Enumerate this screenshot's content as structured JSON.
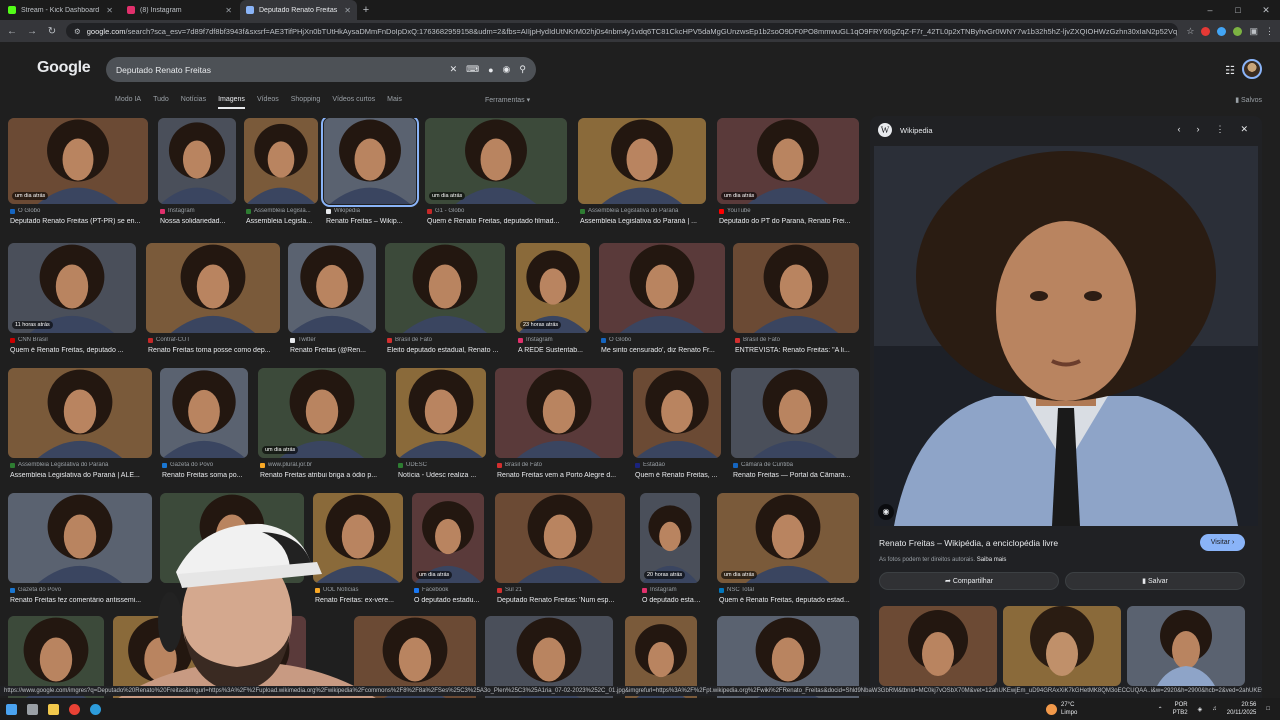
{
  "browser": {
    "tabs": [
      {
        "title": "Stream - Kick Dashboard",
        "color": "#53fc18"
      },
      {
        "title": "(8) Instagram",
        "color": "#e1306c"
      },
      {
        "title": "Deputado Renato Freitas - Pesq",
        "color": "#8ab4f8"
      }
    ],
    "url_host": "google.com",
    "url_rest": "/search?sca_esv=7d89f7df8bf3943f&sxsrf=AE3TifPHjXn0bTUtHkAysaDMmFnDoIpDxQ:1763682959158&udm=2&fbs=AIIjpHydIdUtNKrM02hj0s4nbm4y1vdq6TC81CkcHPV5daMgGUnzwsEp1b2soO9DF0PO8mmwuGL1qO9FRY60gZqZ-F7r_42TL0p2xTNByhvGr0WNY7w1b32h5hZ-ljvZXQIOHWzGzhn30xIaN2p52Vq"
  },
  "google": {
    "logo": "Google",
    "query": "Deputado Renato Freitas",
    "nav": [
      "Modo IA",
      "Tudo",
      "Notícias",
      "Imagens",
      "Vídeos",
      "Shopping",
      "Vídeos curtos",
      "Mais"
    ],
    "active_nav": "Imagens",
    "tools": "Ferramentas",
    "saved": "Salvos"
  },
  "results": [
    {
      "src": "O Globo",
      "cap": "Deputado Renato Freitas (PT-PR) se en...",
      "badge": "um dia atrás",
      "c": "#1565c0"
    },
    {
      "src": "Instagram",
      "cap": "Nossa solidariedad...",
      "badge": "",
      "c": "#e1306c"
    },
    {
      "src": "Assembleia Legisla...",
      "cap": "Assembleia Legisla...",
      "badge": "",
      "c": "#2e7d32"
    },
    {
      "src": "Wikipedia",
      "cap": "Renato Freitas – Wikip...",
      "badge": "",
      "c": "#e8eaed"
    },
    {
      "src": "G1 - Globo",
      "cap": "Quem é Renato Freitas, deputado filmad...",
      "badge": "um dia atrás",
      "c": "#c62828"
    },
    {
      "src": "Assembleia Legislativa do Paraná",
      "cap": "Assembleia Legislativa do Paraná | ...",
      "badge": "",
      "c": "#2e7d32"
    },
    {
      "src": "YouTube",
      "cap": "Deputado do PT do Paraná, Renato Frei...",
      "badge": "um dia atrás",
      "c": "#ff0000"
    },
    {
      "src": "CNN Brasil",
      "cap": "Quem é Renato Freitas, deputado ...",
      "badge": "11 horas atrás",
      "c": "#cc0000"
    },
    {
      "src": "Contraf-CUT",
      "cap": "Renato Freitas toma posse como dep...",
      "badge": "",
      "c": "#c62828"
    },
    {
      "src": "Twitter",
      "cap": "Renato Freitas (@Ren...",
      "badge": "",
      "c": "#e8eaed"
    },
    {
      "src": "Brasil de Fato",
      "cap": "Eleito deputado estadual, Renato ...",
      "badge": "",
      "c": "#d32f2f"
    },
    {
      "src": "Instagram",
      "cap": "A REDE Sustentab...",
      "badge": "23 horas atrás",
      "c": "#e1306c"
    },
    {
      "src": "O Globo",
      "cap": "Me sinto censurado', diz Renato Fr...",
      "badge": "",
      "c": "#1565c0"
    },
    {
      "src": "Brasil de Fato",
      "cap": "ENTREVISTA: Renato Freitas: \"A li...",
      "badge": "",
      "c": "#d32f2f"
    },
    {
      "src": "Assembleia Legislativa do Paraná",
      "cap": "Assembleia Legislativa do Paraná | ALE...",
      "badge": "",
      "c": "#2e7d32"
    },
    {
      "src": "Gazeta do Povo",
      "cap": "Renato Freitas soma po...",
      "badge": "",
      "c": "#1976d2"
    },
    {
      "src": "www.plural.jor.br",
      "cap": "Renato Freitas atribui briga a ódio p...",
      "badge": "um dia atrás",
      "c": "#f9a825"
    },
    {
      "src": "UDESC",
      "cap": "Notícia - Udesc realiza ...",
      "badge": "",
      "c": "#2e7d32"
    },
    {
      "src": "Brasil de Fato",
      "cap": "Renato Freitas vem a Porto Alegre d...",
      "badge": "",
      "c": "#d32f2f"
    },
    {
      "src": "Estadão",
      "cap": "Quem é Renato Freitas, ...",
      "badge": "",
      "c": "#1a237e"
    },
    {
      "src": "Câmara de Curitiba",
      "cap": "Renato Freitas — Portal da Câmara...",
      "badge": "",
      "c": "#1565c0"
    },
    {
      "src": "Gazeta do Povo",
      "cap": "Renato Freitas fez comentário antissemi...",
      "badge": "",
      "c": "#1976d2"
    },
    {
      "src": "",
      "cap": "",
      "badge": "",
      "c": "#555"
    },
    {
      "src": "UOL Notícias",
      "cap": "Renato Freitas: ex-vere...",
      "badge": "",
      "c": "#f9a825"
    },
    {
      "src": "Facebook",
      "cap": "O deputado estadu...",
      "badge": "um dia atrás",
      "c": "#1877f2"
    },
    {
      "src": "Sul 21",
      "cap": "Deputado Renato Freitas: 'Num esp...",
      "badge": "",
      "c": "#d32f2f"
    },
    {
      "src": "Instagram",
      "cap": "O deputado estadu...",
      "badge": "20 horas atrás",
      "c": "#e1306c"
    },
    {
      "src": "NSC Total",
      "cap": "Quem é Renato Freitas, deputado estad...",
      "badge": "um dia atrás",
      "c": "#0277bd"
    },
    {
      "src": "",
      "cap": "",
      "badge": "",
      "c": "#555"
    },
    {
      "src": "",
      "cap": "",
      "badge": "",
      "c": "#555"
    },
    {
      "src": "",
      "cap": "",
      "badge": "",
      "c": "#555"
    },
    {
      "src": "",
      "cap": "",
      "badge": "",
      "c": "#555"
    },
    {
      "src": "",
      "cap": "",
      "badge": "",
      "c": "#555"
    },
    {
      "src": "",
      "cap": "",
      "badge": "",
      "c": "#555"
    },
    {
      "src": "",
      "cap": "",
      "badge": "",
      "c": "#555"
    }
  ],
  "preview": {
    "source": "Wikipedia",
    "title": "Renato Freitas – Wikipédia, a enciclopédia livre",
    "note": "As fotos podem ter direitos autorais.",
    "note_link": "Saiba mais",
    "visit": "Visitar",
    "share": "Compartilhar",
    "save": "Salvar"
  },
  "status_url": "https://www.google.com/imgres?q=Deputado%20Renato%20Freitas&imgurl=https%3A%2F%2Fupload.wikimedia.org%2Fwikipedia%2Fcommons%2F8%2F8a%2FSes%25C3%25A3o_Plen%25C3%25A1ria_07-02-2023%252C_01.jpg&imgrefurl=https%3A%2F%2Fpt.wikipedia.org%2Fwiki%2FRenato_Freitas&docid=Shld9NbaW3GbRM&tbnid=MC0kj7vOSbX70M&vet=12ahUKEwjEm_uD94GRAxXiK7kGHetMK8QM3oECCUQAA..i&w=2920&h=2900&hcb=2&ved=2ahUKEwjEm_uD94GR...",
  "taskbar": {
    "temp": "27°C",
    "weather": "Limpo",
    "lang1": "POR",
    "lang2": "PTB2",
    "time": "20:56",
    "date": "20/11/2025"
  }
}
